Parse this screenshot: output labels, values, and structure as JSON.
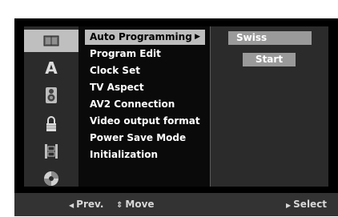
{
  "sidebar": {
    "icons": [
      "disc-icon",
      "language-icon",
      "audio-icon",
      "lock-icon",
      "film-icon",
      "other-icon"
    ],
    "language_glyph": "A"
  },
  "menu": {
    "items": [
      {
        "label": "Auto Programming",
        "selected": true
      },
      {
        "label": "Program Edit"
      },
      {
        "label": "Clock Set"
      },
      {
        "label": "TV Aspect"
      },
      {
        "label": "AV2 Connection"
      },
      {
        "label": "Video output format"
      },
      {
        "label": "Power Save Mode"
      },
      {
        "label": "Initialization"
      }
    ]
  },
  "submenu": {
    "country_value": "Swiss",
    "start_label": "Start"
  },
  "footer": {
    "prev_label": "Prev.",
    "move_label": "Move",
    "select_label": "Select"
  },
  "colors": {
    "background": "#000000",
    "highlight": "#bdbdbd",
    "panel": "#2b2b2b",
    "button": "#9a9a9a",
    "text": "#ffffff"
  }
}
